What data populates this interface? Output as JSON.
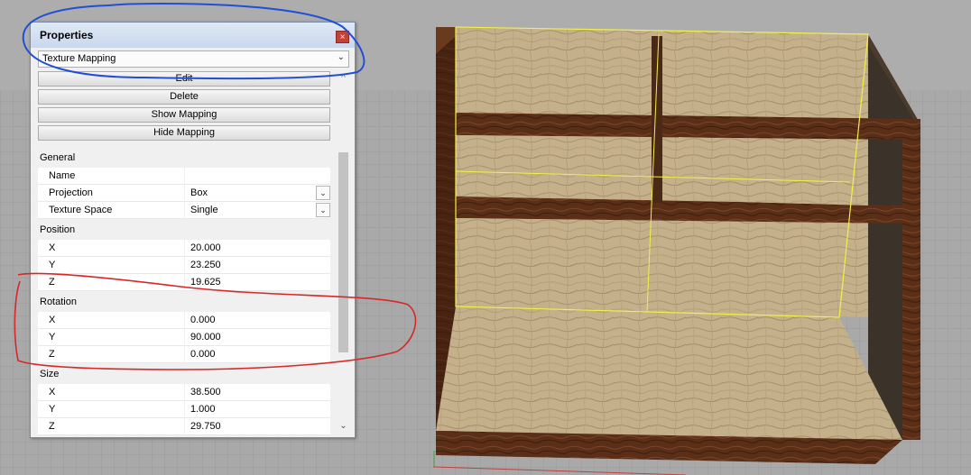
{
  "panel": {
    "title": "Properties",
    "close_glyph": "×",
    "mode": "Texture Mapping",
    "chevron": "⌄"
  },
  "buttons": {
    "edit": "Edit",
    "delete": "Delete",
    "show_mapping": "Show Mapping",
    "hide_mapping": "Hide Mapping"
  },
  "general": {
    "header": "General",
    "name_label": "Name",
    "name_value": "",
    "projection_label": "Projection",
    "projection_value": "Box",
    "texture_space_label": "Texture Space",
    "texture_space_value": "Single"
  },
  "position": {
    "header": "Position",
    "x_label": "X",
    "x_value": "20.000",
    "y_label": "Y",
    "y_value": "23.250",
    "z_label": "Z",
    "z_value": "19.625"
  },
  "rotation": {
    "header": "Rotation",
    "x_label": "X",
    "x_value": "0.000",
    "y_label": "Y",
    "y_value": "90.000",
    "z_label": "Z",
    "z_value": "0.000"
  },
  "size": {
    "header": "Size",
    "x_label": "X",
    "x_value": "38.500",
    "y_label": "Y",
    "y_value": "1.000",
    "z_label": "Z",
    "z_value": "29.750"
  },
  "scroll": {
    "up": "▲",
    "down": "⌄",
    "up_glyph": "^"
  },
  "icons": {
    "close": "close-icon",
    "dropdown": "chevron-down-icon"
  },
  "colors": {
    "viewport_bg": "#a9a9a9",
    "wood_light": "#c1ad87",
    "wood_dark": "#5a2e17",
    "selection": "#f2f04a",
    "annotation_blue": "#1f4fd6",
    "annotation_red": "#d62828"
  }
}
